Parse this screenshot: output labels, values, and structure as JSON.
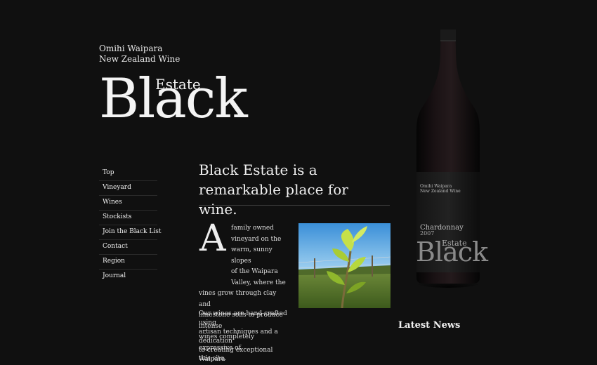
{
  "header": {
    "tagline_line1": "Omihi Waipara",
    "tagline_line2": "New Zealand Wine",
    "logo_small": "Estate",
    "logo_large": "Black"
  },
  "nav": {
    "items": [
      "Top",
      "Vineyard",
      "Wines",
      "Stockists",
      "Join the Black List",
      "Contact",
      "Region",
      "Journal"
    ]
  },
  "main": {
    "headline": "Black Estate is a remarkable place for wine.",
    "dropcap": "A",
    "para1_lines": [
      "family owned",
      "vineyard on the",
      "warm, sunny slopes",
      "of the Waipara",
      "Valley, where the",
      "vines grow through clay and",
      "limestone soils to produce intense",
      "wines completely expressive of",
      "this site."
    ],
    "para2_lines": [
      "Our wines are hand crafted using",
      "artisan techniques and a dedication",
      "to creating exceptional Waipara"
    ]
  },
  "bottle": {
    "label_line1": "Omihi Waipara",
    "label_line2": "New Zealand Wine",
    "varietal": "Chardonnay",
    "year": "2007",
    "estate": "Estate",
    "black": "Black"
  },
  "sidebar": {
    "news_heading": "Latest News"
  }
}
